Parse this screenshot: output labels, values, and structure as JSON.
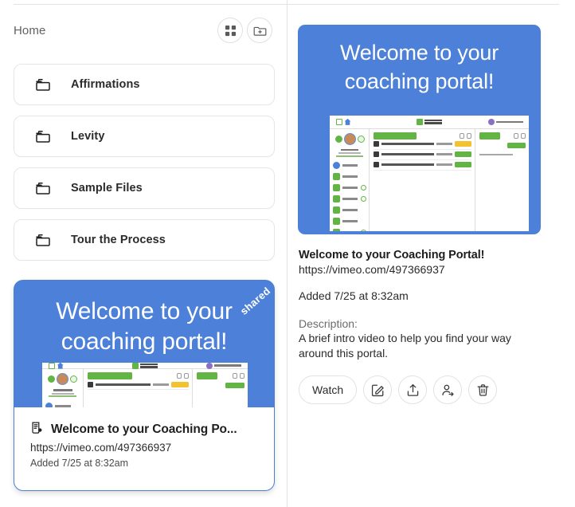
{
  "left_panel": {
    "breadcrumb": "Home",
    "header_actions": [
      {
        "name": "grid-view-icon",
        "label": "Grid view"
      },
      {
        "name": "add-folder-icon",
        "label": "New folder"
      }
    ],
    "folders": [
      {
        "label": "Affirmations",
        "icon": "folder-icon"
      },
      {
        "label": "Levity",
        "icon": "folder-icon"
      },
      {
        "label": "Sample Files",
        "icon": "folder-icon"
      },
      {
        "label": "Tour the Process",
        "icon": "folder-icon"
      }
    ],
    "media_card": {
      "hero_title": "Welcome to your coaching portal!",
      "shared_badge": "shared",
      "title": "Welcome to your Coaching Po...",
      "url": "https://vimeo.com/497366937",
      "added": "Added 7/25 at 8:32am",
      "item_icon": "document-icon",
      "accent": "#4d80d8"
    }
  },
  "detail_panel": {
    "hero_title": "Welcome to your coaching portal!",
    "title": "Welcome to your Coaching Portal!",
    "url": "https://vimeo.com/497366937",
    "added": "Added 7/25 at 8:32am",
    "description_label": "Description:",
    "description": "A brief intro video to help you find your way around this portal.",
    "actions": {
      "watch_label": "Watch",
      "edit_icon": "edit-square-icon",
      "share_icon": "upload-share-icon",
      "add_person_icon": "person-add-icon",
      "delete_icon": "trash-icon"
    },
    "accent": "#4d80d8"
  }
}
